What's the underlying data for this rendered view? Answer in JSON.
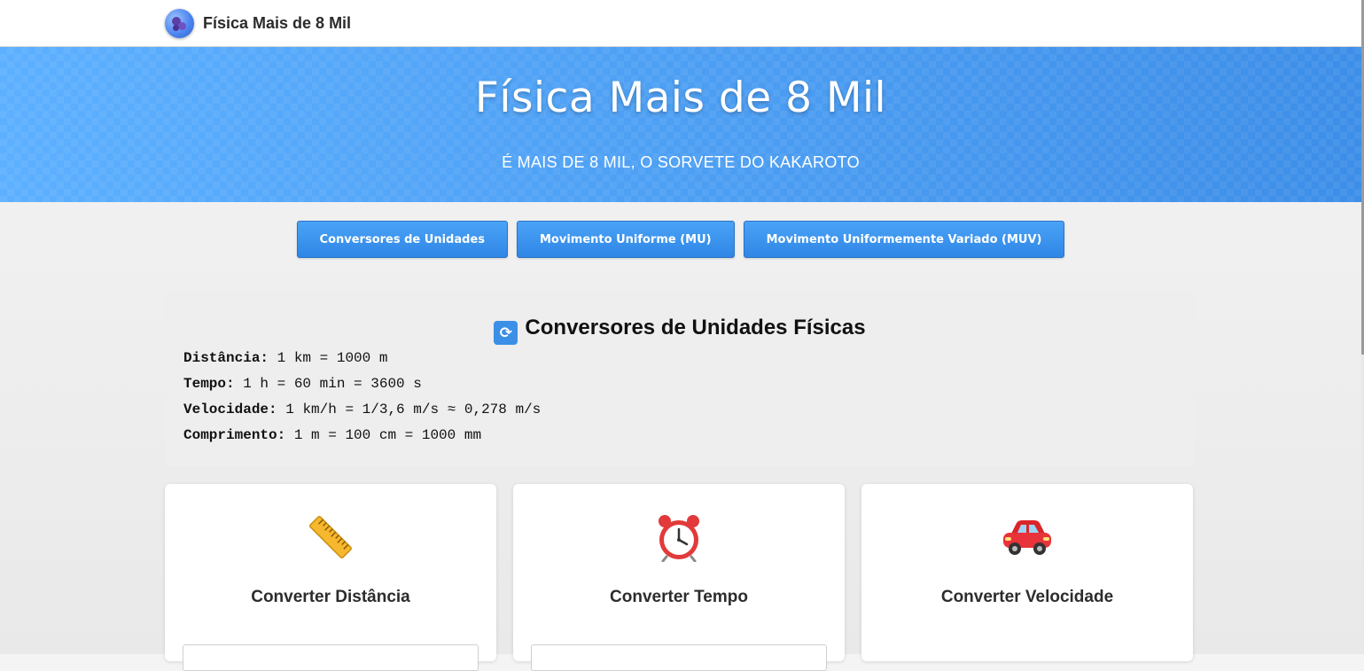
{
  "nav": {
    "brand": "Física Mais de 8 Mil"
  },
  "hero": {
    "title": "Física Mais de 8 Mil",
    "subtitle": "É MAIS DE 8 MIL, O SORVETE DO KAKAROTO"
  },
  "tabs": [
    {
      "label": "Conversores de Unidades"
    },
    {
      "label": "Movimento Uniforme (MU)"
    },
    {
      "label": "Movimento Uniformemente Variado (MUV)"
    }
  ],
  "reference": {
    "icon": "arrows-cycle-icon",
    "title": "Conversores de Unidades Físicas",
    "lines": [
      {
        "label": "Distância:",
        "value": "1 km = 1000 m"
      },
      {
        "label": "Tempo:",
        "value": "1 h = 60 min = 3600 s"
      },
      {
        "label": "Velocidade:",
        "value": "1 km/h = 1/3,6 m/s ≈ 0,278 m/s"
      },
      {
        "label": "Comprimento:",
        "value": "1 m = 100 cm = 1000 mm"
      }
    ]
  },
  "cards": [
    {
      "icon": "ruler-icon",
      "title": "Converter Distância"
    },
    {
      "icon": "alarm-clock-icon",
      "title": "Converter Tempo"
    },
    {
      "icon": "car-icon",
      "title": "Converter Velocidade"
    }
  ],
  "colors": {
    "accent": "#3b8fe6",
    "hero": "#4b9cf0",
    "background": "#eeeeee"
  }
}
